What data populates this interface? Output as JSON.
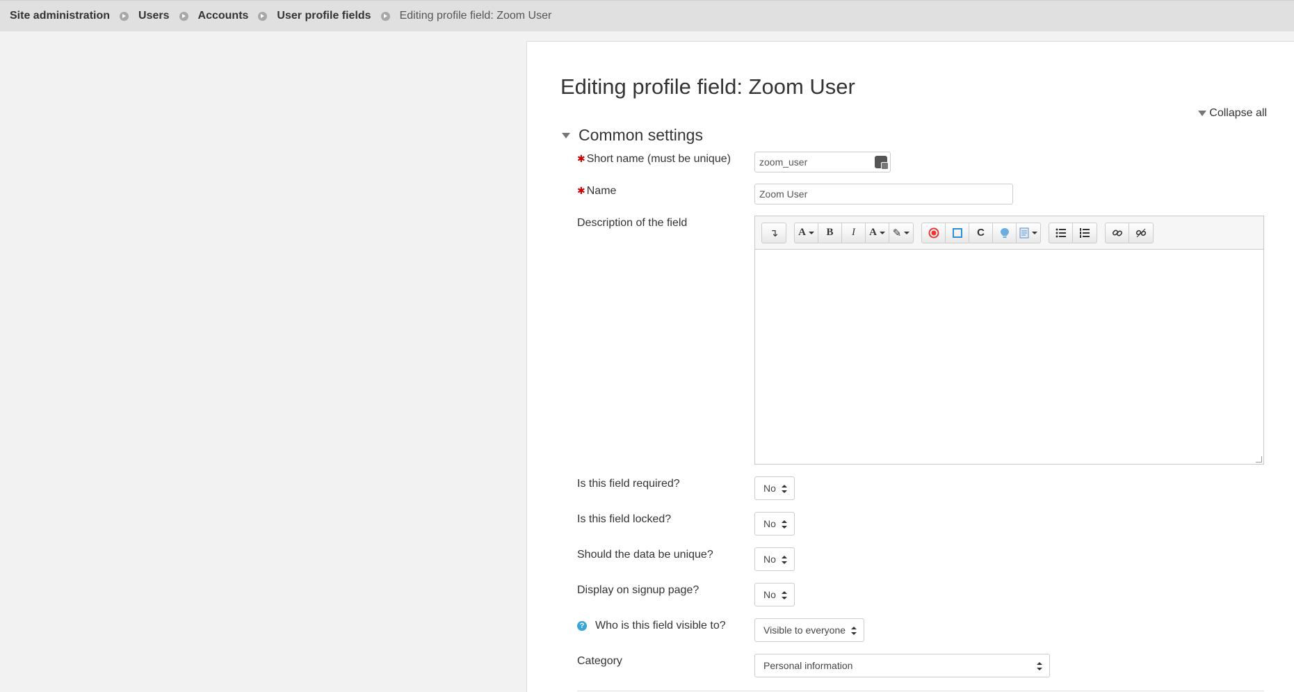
{
  "breadcrumb": {
    "items": [
      "Site administration",
      "Users",
      "Accounts",
      "User profile fields"
    ],
    "current": "Editing profile field: Zoom User"
  },
  "page": {
    "title": "Editing profile field: Zoom User",
    "collapse_all": "Collapse all"
  },
  "section": {
    "title": "Common settings"
  },
  "fields": {
    "shortname": {
      "label": "Short name (must be unique)",
      "value": "zoom_user"
    },
    "name": {
      "label": "Name",
      "value": "Zoom User"
    },
    "description": {
      "label": "Description of the field",
      "value": ""
    },
    "required": {
      "label": "Is this field required?",
      "value": "No"
    },
    "locked": {
      "label": "Is this field locked?",
      "value": "No"
    },
    "unique": {
      "label": "Should the data be unique?",
      "value": "No"
    },
    "signup": {
      "label": "Display on signup page?",
      "value": "No"
    },
    "visible": {
      "label": "Who is this field visible to?",
      "value": "Visible to everyone"
    },
    "category": {
      "label": "Category",
      "value": "Personal information"
    }
  },
  "editor": {
    "toolbar_icons": [
      "show-more-buttons-icon",
      "paragraph-styles-icon",
      "bold-icon",
      "italic-icon",
      "font-color-icon",
      "highlight-icon",
      "record-audio-icon",
      "record-video-icon",
      "cloud-poodll-icon",
      "whiteboard-icon",
      "templates-icon",
      "unordered-list-icon",
      "ordered-list-icon",
      "link-icon",
      "unlink-icon"
    ],
    "glyphs": {
      "bold": "B",
      "italic": "I",
      "font": "A"
    }
  },
  "colors": {
    "required_marker": "#cc0000",
    "help_icon": "#38a6d8",
    "breadcrumb_bg": "#e0e0e0",
    "page_bg": "#f2f2f2"
  }
}
